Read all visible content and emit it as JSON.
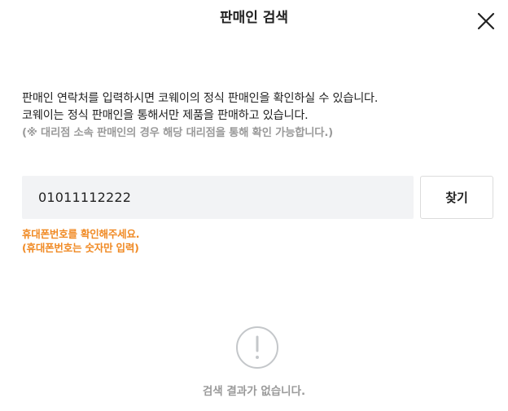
{
  "modal": {
    "title": "판매인 검색"
  },
  "description": {
    "line1": "판매인 연락처를 입력하시면 코웨이의 정식 판매인을 확인하실 수 있습니다.",
    "line2": "코웨이는 정식 판매인을 통해서만 제품을 판매하고 있습니다.",
    "note": "(※ 대리점 소속 판매인의 경우 해당 대리점을 통해 확인 가능합니다.)"
  },
  "search": {
    "value": "01011112222",
    "button_label": "찾기"
  },
  "error": {
    "line1": "휴대폰번호를 확인해주세요.",
    "line2": "(휴대폰번호는 숫자만 입력)"
  },
  "result": {
    "empty_icon": "exclamation-circle-icon",
    "empty_text": "검색 결과가 없습니다."
  },
  "colors": {
    "error": "#f08a24",
    "muted": "#9a9a9a",
    "input_bg": "#f2f3f5"
  }
}
